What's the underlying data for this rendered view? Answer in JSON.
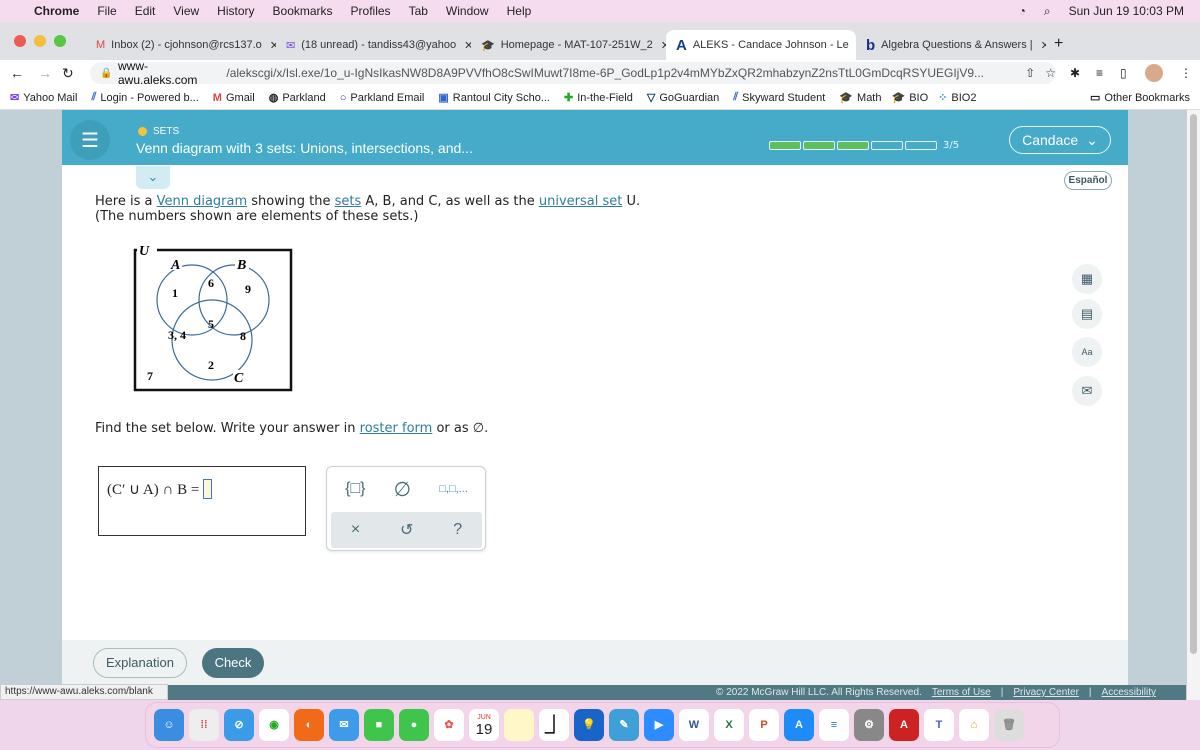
{
  "menubar": {
    "app": "Chrome",
    "items": [
      "File",
      "Edit",
      "View",
      "History",
      "Bookmarks",
      "Profiles",
      "Tab",
      "Window",
      "Help"
    ],
    "datetime": "Sun Jun 19  10:03 PM"
  },
  "tabs": [
    {
      "title": "Inbox (2) - cjohnson@rcs137.o",
      "icon": "gmail-icon"
    },
    {
      "title": "(18 unread) - tandiss43@yahoo",
      "icon": "yahoo-mail-icon"
    },
    {
      "title": "Homepage - MAT-107-251W_2",
      "icon": "course-icon"
    },
    {
      "title": "ALEKS - Candace Johnson - Le",
      "icon": "aleks-icon",
      "active": true
    },
    {
      "title": "Algebra Questions & Answers |",
      "icon": "bartleby-icon"
    }
  ],
  "address": {
    "host": "www-awu.aleks.com",
    "path": "/alekscgi/x/Isl.exe/1o_u-IgNsIkasNW8D8A9PVVfhO8cSwIMuwt7I8me-6P_GodLp1p2v4mMYbZxQR2mhabzynZ2nsTtL0GmDcqRSYUEGIjV9..."
  },
  "bookmarks": [
    "Yahoo Mail",
    "Login - Powered b...",
    "Gmail",
    "Parkland",
    "Parkland Email",
    "Rantoul City Scho...",
    "In-the-Field",
    "GoGuardian",
    "Skyward Student",
    "Math",
    "BIO",
    "BIO2"
  ],
  "other_bookmarks": "Other Bookmarks",
  "aleks": {
    "category": "SETS",
    "topic": "Venn diagram with 3 sets: Unions, intersections, and...",
    "progress": {
      "completed": 3,
      "total": 5,
      "label": "3/5"
    },
    "user": "Candace",
    "language": "Español",
    "intro": {
      "p1": "Here is a ",
      "l1": "Venn diagram",
      "p2": " showing the ",
      "l2": "sets",
      "p3": " A, B, and C, as well as the ",
      "l3": "universal set",
      "p4": " U.",
      "line2": "(The numbers shown are elements of these sets.)"
    },
    "venn": {
      "U": "U",
      "A": "A",
      "B": "B",
      "C": "C",
      "only_A": "1",
      "A_B": "6",
      "only_B": "9",
      "A_C": "3, 4",
      "A_B_C": "5",
      "B_C": "8",
      "only_C": "2",
      "outside": "7"
    },
    "instruction": {
      "p1": "Find the set below. Write your answer in ",
      "link": "roster form",
      "p2": " or as ∅."
    },
    "expression": {
      "lhs": "(C′ ∪ A) ∩ B =",
      "value": ""
    },
    "pad": {
      "braces": "{□}",
      "empty": "∅",
      "list": "□,□,...",
      "clear": "×",
      "undo": "↺",
      "help": "?"
    },
    "explanation": "Explanation",
    "check": "Check"
  },
  "status_url": "https://www-awu.aleks.com/blank",
  "footer": {
    "copyright": "© 2022 McGraw Hill LLC. All Rights Reserved.",
    "links": [
      "Terms of Use",
      "Privacy Center",
      "Accessibility"
    ]
  },
  "dock": {
    "calendar_month": "JUN",
    "calendar_day": "19"
  },
  "colors": {
    "header": "#45abc8",
    "progress_done": "#5ebf5e",
    "check": "#4b7580",
    "footer": "#507983"
  }
}
